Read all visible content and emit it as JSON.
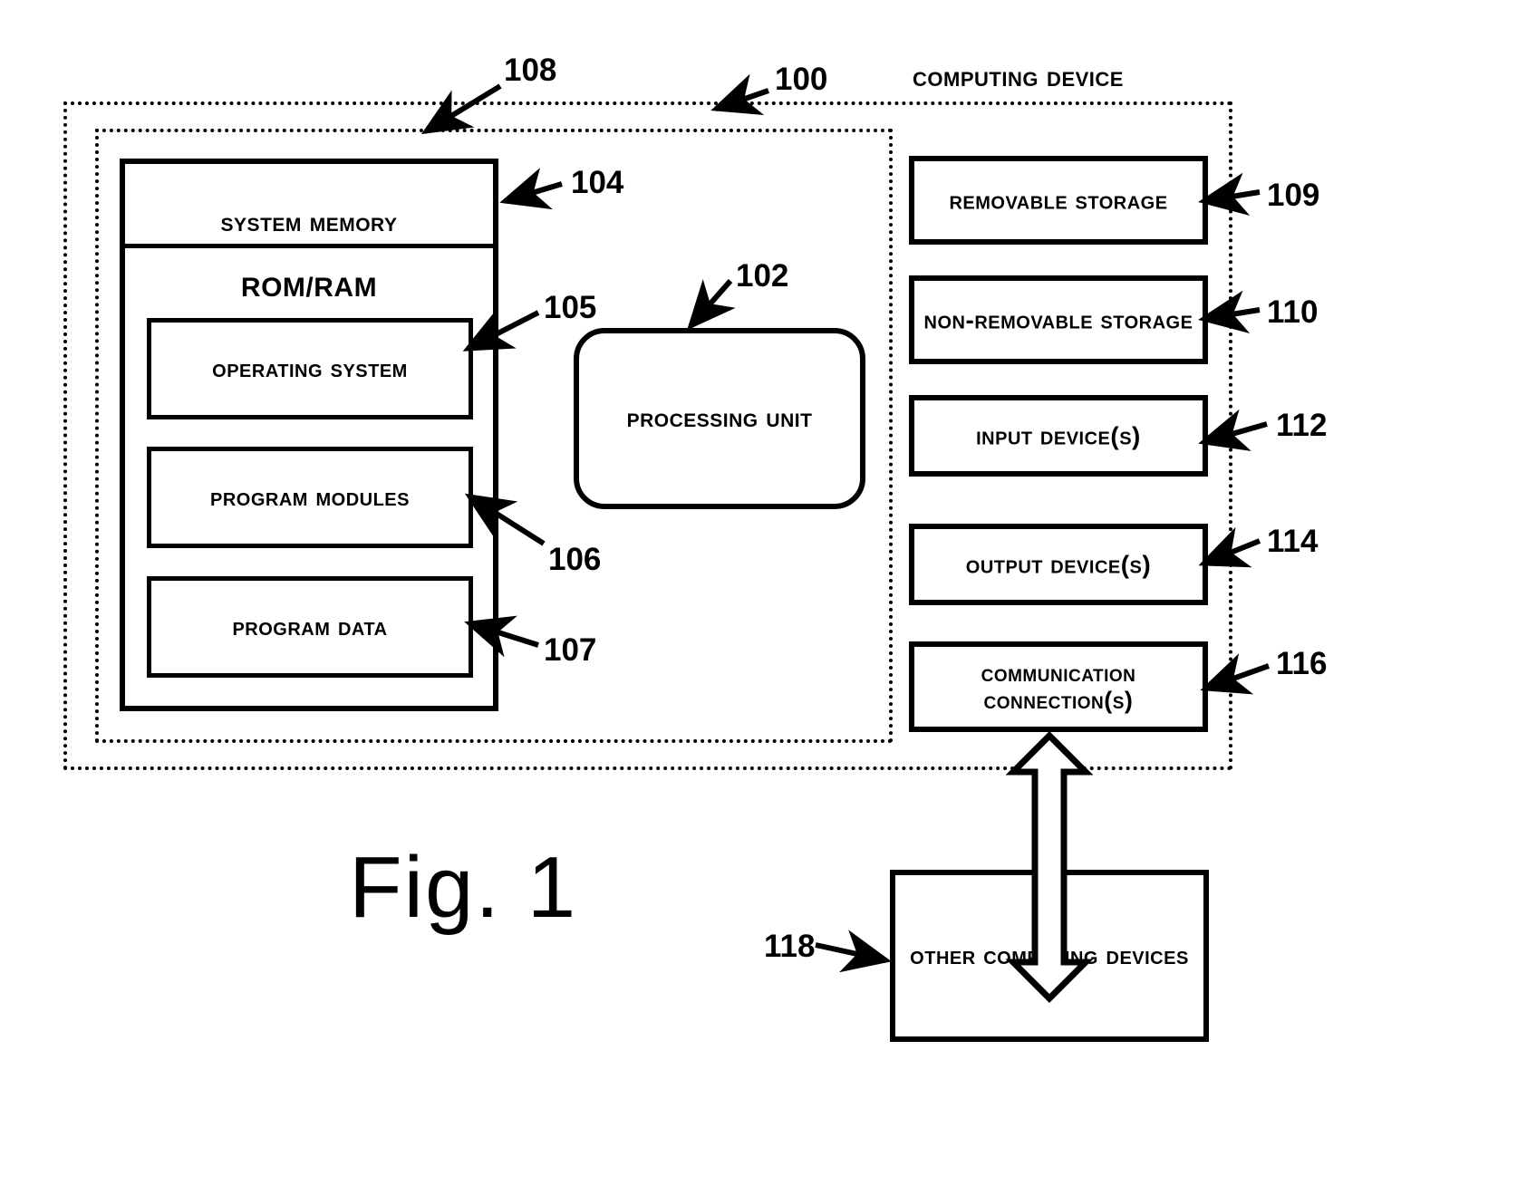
{
  "figure": {
    "title": "Fig. 1",
    "caption_computing_device": "Computing Device"
  },
  "containers": {
    "computing_device": {
      "ref": "100",
      "label": "Computing Device"
    },
    "system_scope": {
      "ref": "108"
    }
  },
  "system_memory": {
    "title": "System Memory",
    "ref": "104",
    "rom_ram": "ROM/RAM",
    "modules": [
      {
        "label": "Operating System",
        "ref": "105"
      },
      {
        "label": "Program Modules",
        "ref": "106"
      },
      {
        "label": "Program Data",
        "ref": "107"
      }
    ]
  },
  "processing_unit": {
    "label": "Processing Unit",
    "ref": "102"
  },
  "peripherals": [
    {
      "label": "Removable Storage",
      "ref": "109"
    },
    {
      "label": "Non-Removable Storage",
      "ref": "110"
    },
    {
      "label": "Input Device(s)",
      "ref": "112"
    },
    {
      "label": "Output Device(s)",
      "ref": "114"
    },
    {
      "label": "Communication Connection(s)",
      "ref": "116"
    }
  ],
  "external": {
    "label": "Other Computing Devices",
    "ref": "118"
  },
  "colors": {
    "ink": "#000000",
    "paper": "#ffffff"
  }
}
